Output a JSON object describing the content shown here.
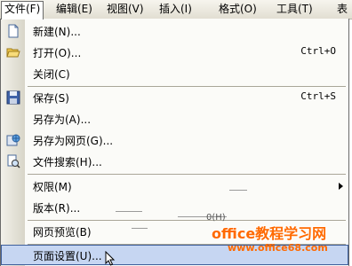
{
  "menubar": {
    "items": [
      {
        "label": "文件(F)",
        "active": true
      },
      {
        "label": "编辑(E)"
      },
      {
        "label": "视图(V)"
      },
      {
        "label": "插入(I)"
      },
      {
        "label": "格式(O)"
      },
      {
        "label": "工具(T)"
      },
      {
        "label": "表"
      }
    ]
  },
  "file_menu": {
    "items": [
      {
        "label": "新建(N)...",
        "icon": "new-document-icon"
      },
      {
        "label": "打开(O)...",
        "shortcut": "Ctrl+O",
        "icon": "open-folder-icon"
      },
      {
        "label": "关闭(C)"
      },
      {
        "label": "保存(S)",
        "shortcut": "Ctrl+S",
        "icon": "save-disk-icon"
      },
      {
        "label": "另存为(A)..."
      },
      {
        "label": "另存为网页(G)...",
        "icon": "save-as-web-icon"
      },
      {
        "label": "文件搜索(H)...",
        "icon": "file-search-icon"
      },
      {
        "label": "权限(M)",
        "has_submenu": true
      },
      {
        "label": "版本(R)..."
      },
      {
        "label": "网页预览(B)"
      },
      {
        "label": "页面设置(U)...",
        "highlighted": true
      }
    ]
  },
  "watermark": {
    "title": "office教程学习网",
    "url": "www.office68.com",
    "noise_text": "0(H)"
  },
  "colors": {
    "menu_bg": "#fbfbf8",
    "gutter": "#d8d5c8",
    "highlight": "#c6d6f2",
    "highlight_border": "#3d5f9c",
    "watermark": "#ff6a00"
  }
}
